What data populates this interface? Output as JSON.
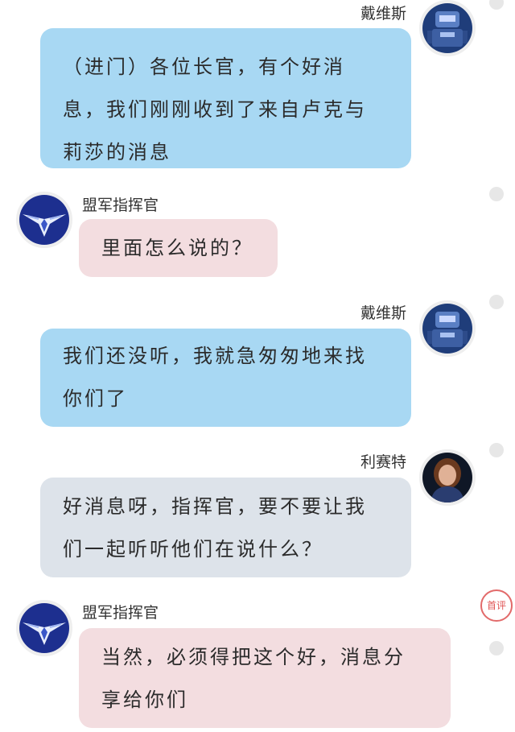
{
  "messages": [
    {
      "sender": "戴维斯",
      "lines": [
        "（进门）各位长官，有个好消",
        "息，我们刚刚收到了来自卢克与",
        "莉莎的消息"
      ]
    },
    {
      "sender": "盟军指挥官",
      "lines": [
        "里面怎么说的？"
      ]
    },
    {
      "sender": "戴维斯",
      "lines": [
        "我们还没听，我就急匆匆地来找",
        "你们了"
      ]
    },
    {
      "sender": "利赛特",
      "lines": [
        "好消息呀，指挥官，要不要让我",
        "们一起听听他们在说什么？"
      ]
    },
    {
      "sender": "盟军指挥官",
      "lines": [
        "当然，必须得把这个好，消息分",
        "享给你们"
      ]
    }
  ],
  "badge": {
    "label": "首评"
  },
  "colors": {
    "blue_bubble": "#a8d8f3",
    "pink_bubble": "#f3dde0",
    "gray_bubble": "#dde3ea"
  },
  "icons": {
    "davis": "robot-avatar-icon",
    "commander": "allied-wings-emblem-icon",
    "lisette": "woman-portrait-avatar"
  }
}
